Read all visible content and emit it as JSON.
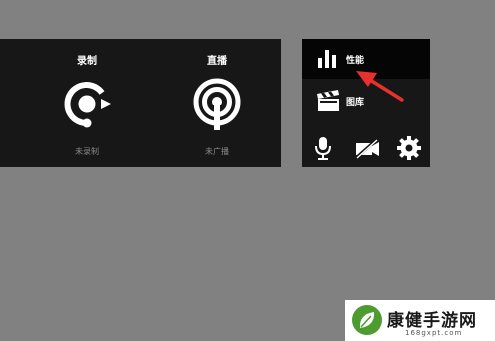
{
  "left_panel": {
    "record": {
      "title": "录制",
      "status": "未录制",
      "icon": "record-icon"
    },
    "live": {
      "title": "直播",
      "status": "未广播",
      "icon": "broadcast-icon"
    }
  },
  "right_panel": {
    "performance": {
      "label": "性能",
      "icon": "bar-chart-icon"
    },
    "gallery": {
      "label": "图库",
      "icon": "clapperboard-icon"
    },
    "bottom_icons": [
      "microphone-icon",
      "camera-off-icon",
      "gear-icon"
    ]
  },
  "annotation": {
    "color": "#e8312f"
  },
  "watermark": {
    "name": "康健手游网",
    "url": "168gxpt.com"
  }
}
